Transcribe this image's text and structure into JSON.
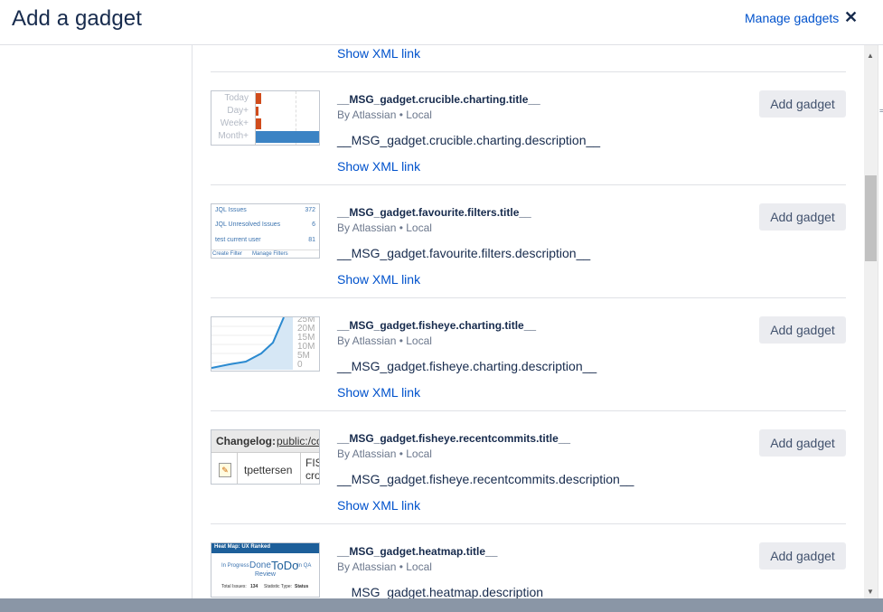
{
  "header": {
    "title": "Add a gadget",
    "manage_link": "Manage gadgets",
    "close_glyph": "✕"
  },
  "top_xml_link": "Show XML link",
  "gadgets": [
    {
      "title": "__MSG_gadget.crucible.charting.title__",
      "by": "By Atlassian • Local",
      "description": "__MSG_gadget.crucible.charting.description__",
      "xml_link": "Show XML link",
      "button": "Add gadget",
      "thumb": {
        "labels": [
          "Today",
          "Day+",
          "Week+",
          "Month+"
        ],
        "values": [
          1,
          1,
          1,
          16
        ]
      }
    },
    {
      "title": "__MSG_gadget.favourite.filters.title__",
      "by": "By Atlassian • Local",
      "description": "__MSG_gadget.favourite.filters.description__",
      "xml_link": "Show XML link",
      "button": "Add gadget",
      "thumb": {
        "rows": [
          {
            "name": "JQL Issues",
            "count": "372"
          },
          {
            "name": "JQL Unresolved Issues",
            "count": "6"
          },
          {
            "name": "test current user",
            "count": "81"
          }
        ],
        "footer": [
          "Create Filter",
          "Manage Filters"
        ]
      }
    },
    {
      "title": "__MSG_gadget.fisheye.charting.title__",
      "by": "By Atlassian • Local",
      "description": "__MSG_gadget.fisheye.charting.description__",
      "xml_link": "Show XML link",
      "button": "Add gadget",
      "thumb": {
        "ticks": [
          "25M",
          "20M",
          "15M",
          "10M",
          "5M",
          "0"
        ]
      }
    },
    {
      "title": "__MSG_gadget.fisheye.recentcommits.title__",
      "by": "By Atlassian • Local",
      "description": "__MSG_gadget.fisheye.recentcommits.description__",
      "xml_link": "Show XML link",
      "button": "Add gadget",
      "thumb": {
        "header": "Changelog:",
        "path": "public:/co",
        "user": "tpettersen",
        "col": "FIS",
        "col2": "cro"
      }
    },
    {
      "title": "__MSG_gadget.heatmap.title__",
      "by": "By Atlassian • Local",
      "description": "__MSG_gadget.heatmap.description__",
      "button": "Add gadget",
      "thumb": {
        "header": "Heat Map: UX Ranked",
        "w1": "In Progress",
        "w2": "Done",
        "w3": "ToDo",
        "w4": "In QA",
        "w5": "Review",
        "footer1": "Total Issues:",
        "footer1v": "134",
        "footer2": "Statistic Type:",
        "footer2v": "Status"
      }
    }
  ],
  "colors": {
    "link": "#0052cc",
    "accent_orange": "#d04c1c",
    "accent_blue": "#3b73af"
  }
}
